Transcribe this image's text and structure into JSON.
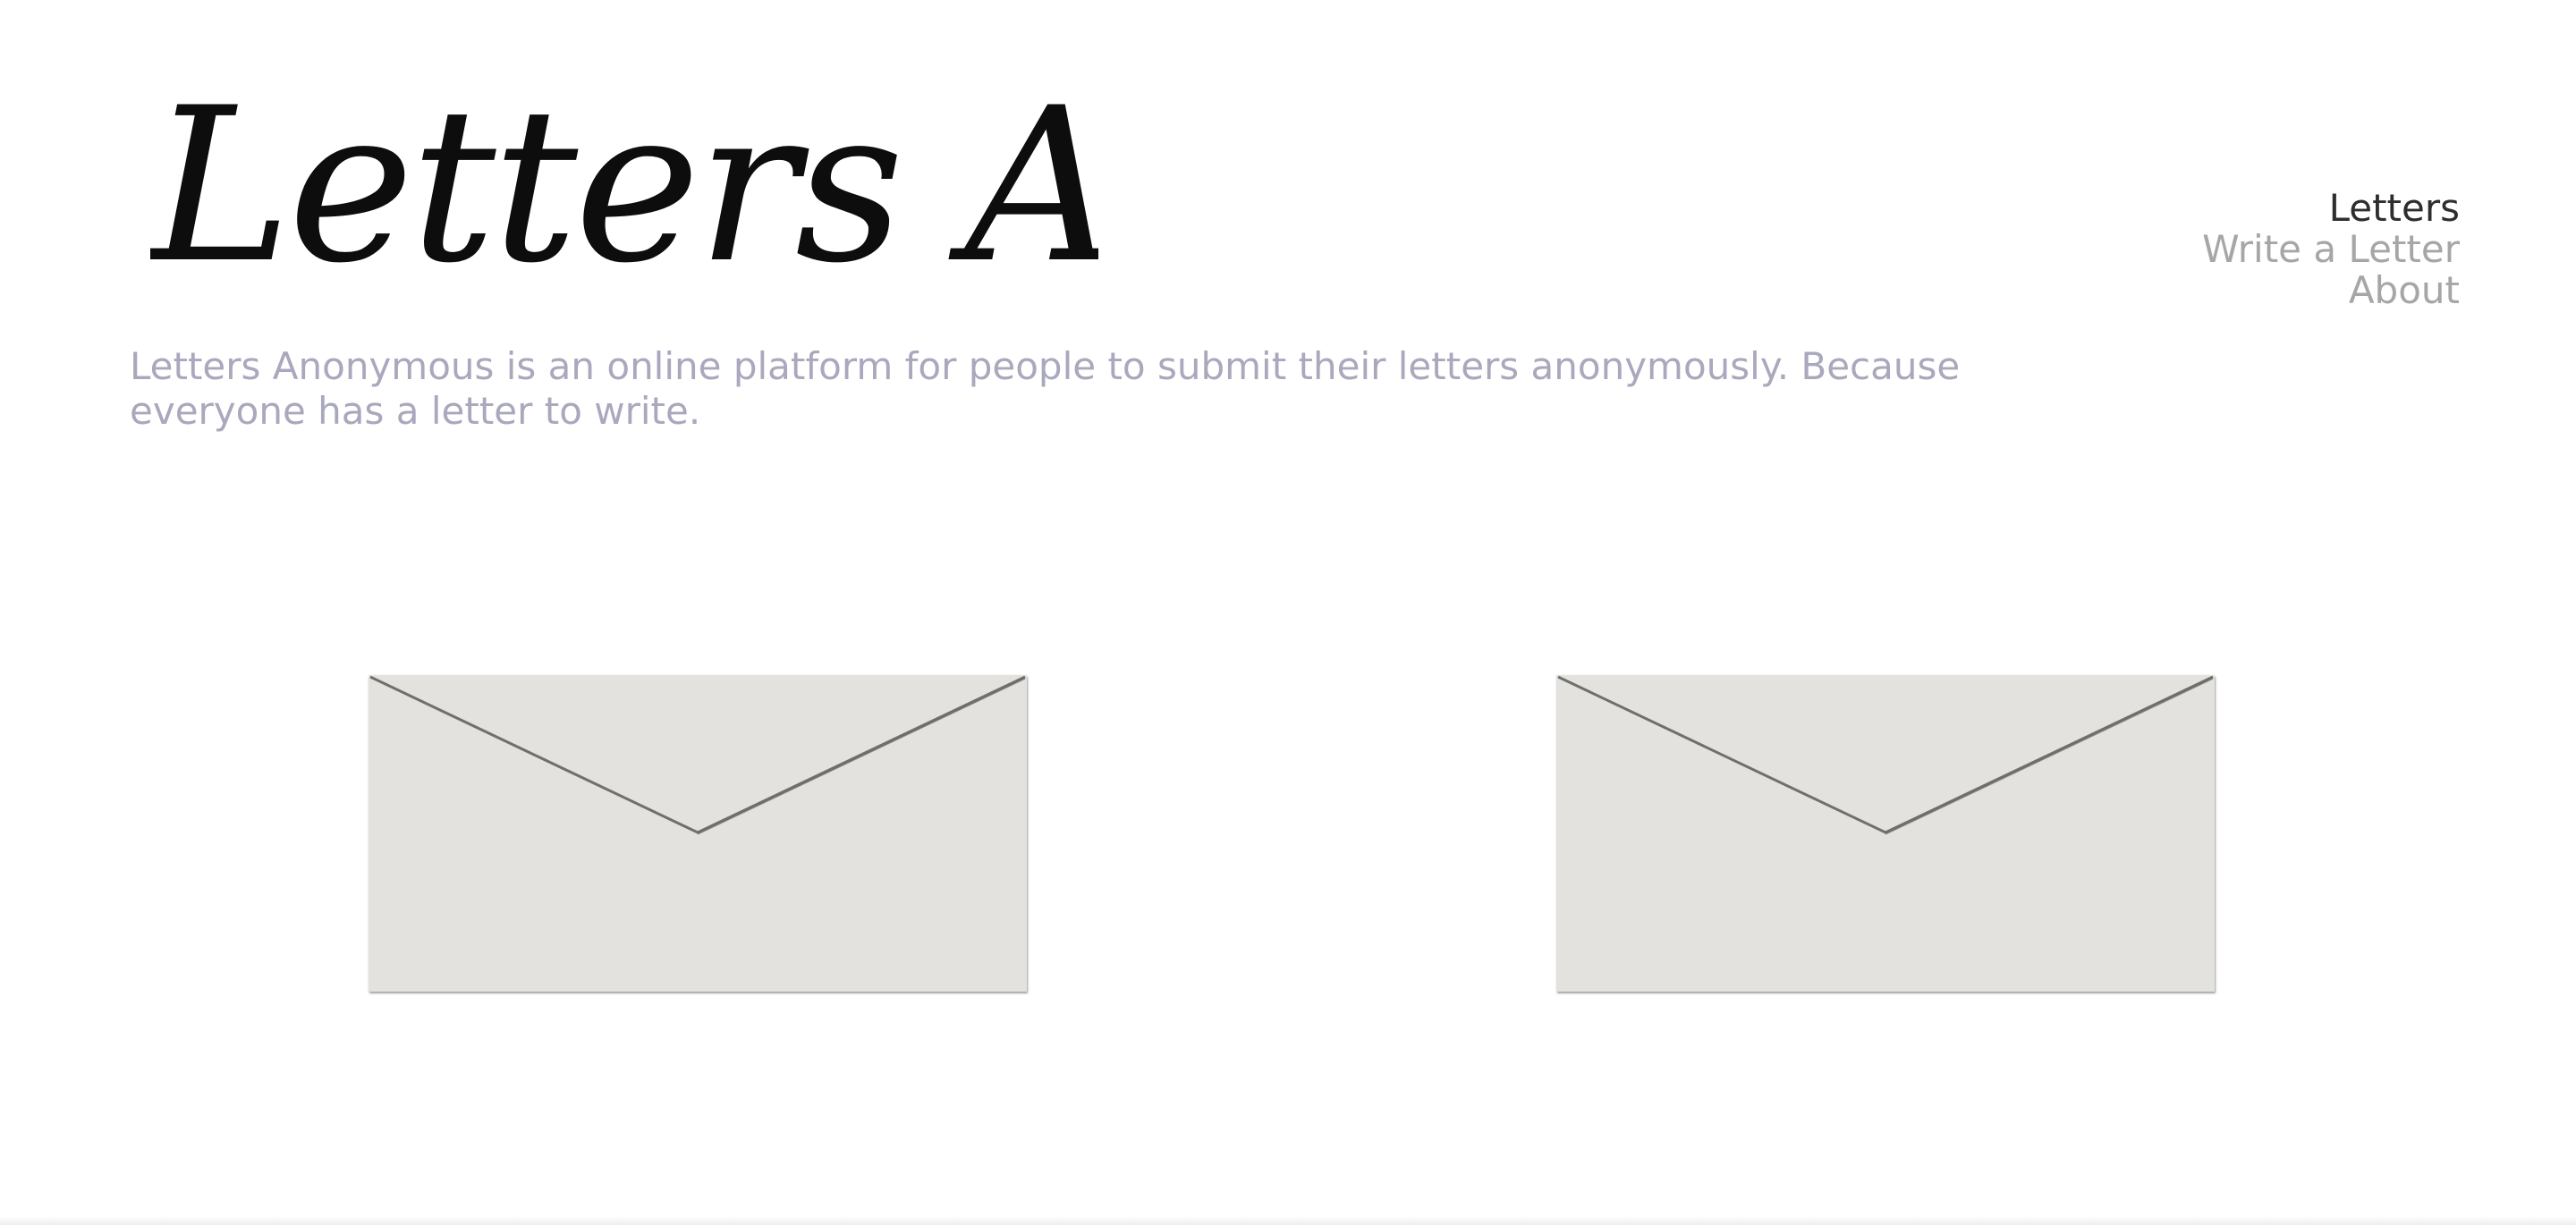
{
  "header": {
    "logo_text": "Letters Anonymous",
    "tagline": "Letters Anonymous is an online platform for people to submit their letters anonymously. Because everyone has a letter to write."
  },
  "nav": {
    "items": [
      {
        "label": "Letters",
        "active": true
      },
      {
        "label": "Write a Letter",
        "active": false
      },
      {
        "label": "About",
        "active": false
      }
    ]
  },
  "letters": [
    {
      "icon": "envelope-icon"
    },
    {
      "icon": "envelope-icon"
    }
  ],
  "colors": {
    "tagline": "#a9a8bd",
    "nav_active": "#2e2e2e",
    "nav_inactive": "#a6a6a6",
    "envelope": "#e3e2de"
  }
}
